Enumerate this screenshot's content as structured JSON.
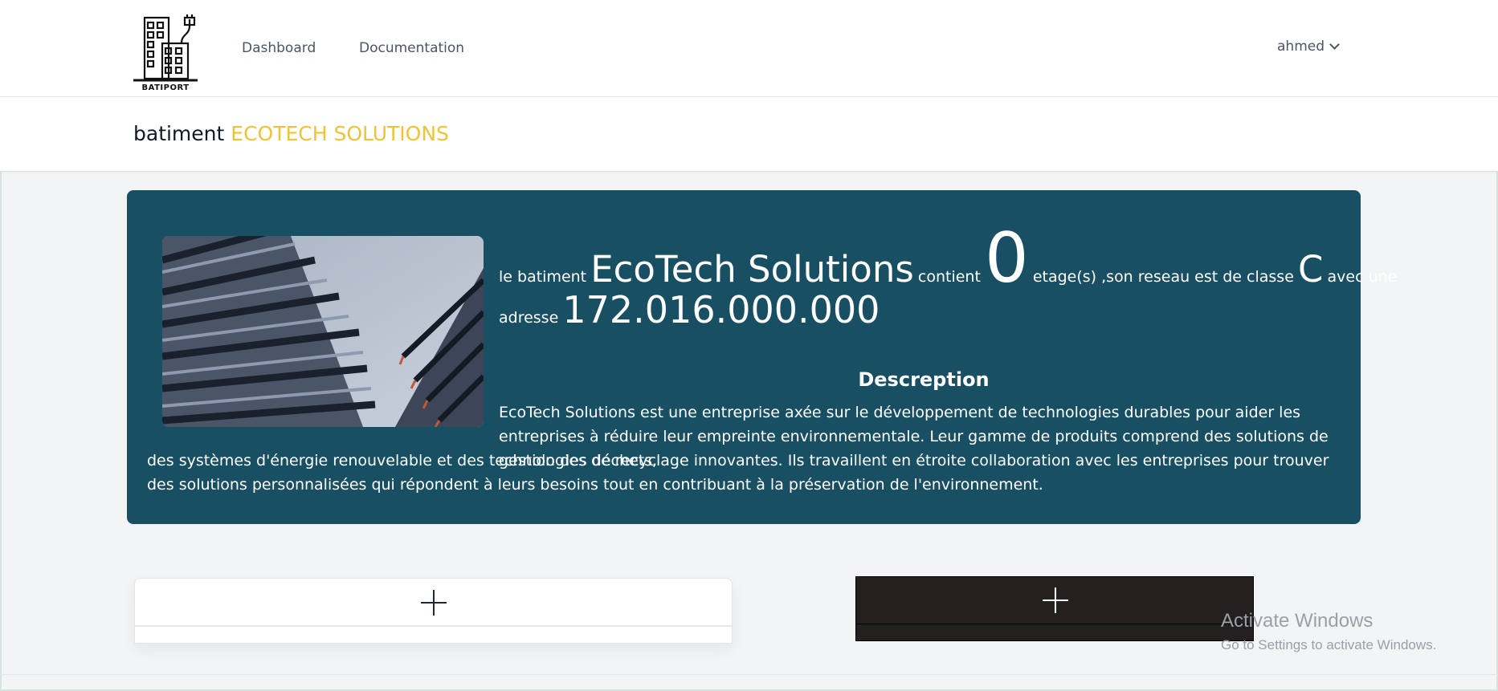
{
  "nav": {
    "logo_text": "BATIPORT",
    "links": [
      {
        "label": "Dashboard"
      },
      {
        "label": "Documentation"
      }
    ],
    "user": "ahmed"
  },
  "header": {
    "title_prefix": "batiment",
    "title_name": "ECOTECH SOLUTIONS"
  },
  "building": {
    "t_le_batiment": "le batiment",
    "name": "EcoTech Solutions",
    "t_contient": "contient",
    "floors": "0",
    "t_etages": "etage(s) ,son reseau est de classe",
    "network_class": "C",
    "t_avec_une": "avec une",
    "t_adresse": "adresse",
    "address": "172.016.000.000",
    "description_title": "Descreption",
    "description_part1": "EcoTech Solutions est une entreprise axée sur le développement de technologies durables pour aider les entreprises à réduire leur empreinte environnementale. Leur gamme de produits comprend des solutions de gestion des déchets,",
    "description_part2": "des systèmes d'énergie renouvelable et des technologies de recyclage innovantes. Ils travaillent en étroite collaboration avec les entreprises pour trouver des solutions personnalisées qui répondent à leurs besoins tout en contribuant à la préservation de l'environnement."
  },
  "watermark": {
    "title": "Activate Windows",
    "subtitle": "Go to Settings to activate Windows."
  },
  "colors": {
    "card_bg": "#184f63",
    "accent": "#f0c23a",
    "dark_panel": "#252020"
  }
}
